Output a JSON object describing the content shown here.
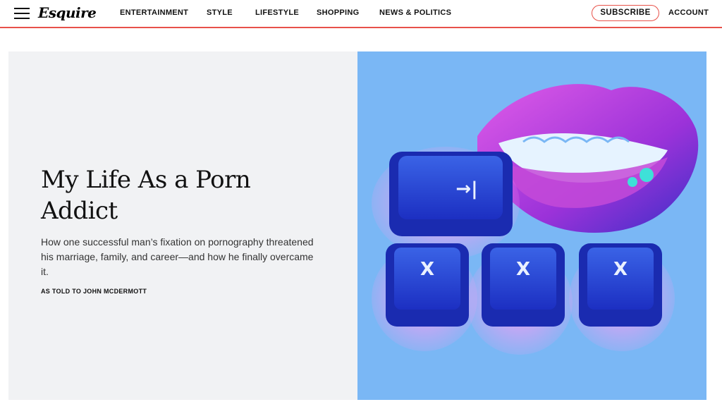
{
  "header": {
    "logo": "Esquire",
    "nav": [
      "ENTERTAINMENT",
      "STYLE",
      "LIFESTYLE",
      "SHOPPING",
      "NEWS & POLITICS"
    ],
    "subscribe_label": "SUBSCRIBE",
    "account_label": "ACCOUNT"
  },
  "article": {
    "headline_line1": "My Life As a Porn",
    "headline_line2": "Addict",
    "dek": "How one successful man’s fixation on pornography threatened his marriage, family, and career—and how he finally overcame it.",
    "byline": "AS TOLD TO JOHN MCDERMOTT"
  },
  "image": {
    "keys": [
      "→|",
      "X",
      "X",
      "X"
    ]
  },
  "colors": {
    "accent": "#e8524a",
    "hero_bg": "#f1f2f4",
    "image_bg": "#7ab7f5"
  }
}
